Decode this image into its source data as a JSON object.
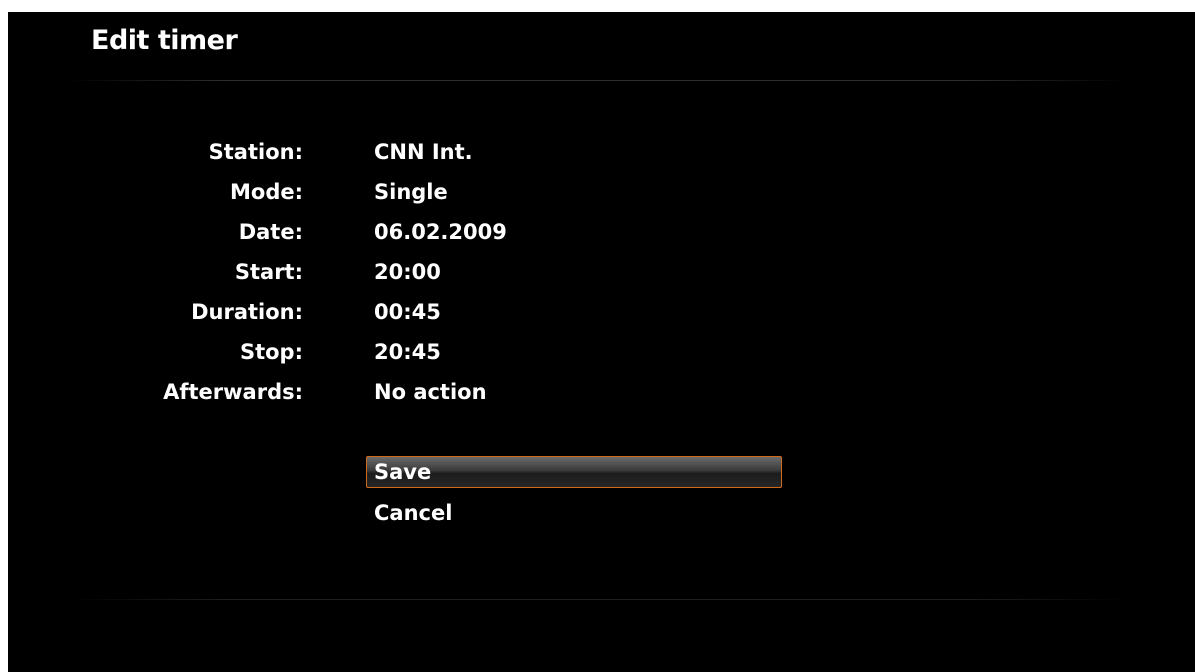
{
  "dialog": {
    "title": "Edit timer"
  },
  "fields": [
    {
      "label": "Station:",
      "value": "CNN Int."
    },
    {
      "label": "Mode:",
      "value": "Single"
    },
    {
      "label": "Date:",
      "value": "06.02.2009"
    },
    {
      "label": "Start:",
      "value": "20:00"
    },
    {
      "label": "Duration:",
      "value": "00:45"
    },
    {
      "label": "Stop:",
      "value": "20:45"
    },
    {
      "label": "Afterwards:",
      "value": "No action"
    }
  ],
  "buttons": {
    "save_label": "Save",
    "cancel_label": "Cancel",
    "focused": "save"
  },
  "colors": {
    "background": "#000000",
    "text": "#ffffff",
    "focus_border": "#d06a1a"
  }
}
